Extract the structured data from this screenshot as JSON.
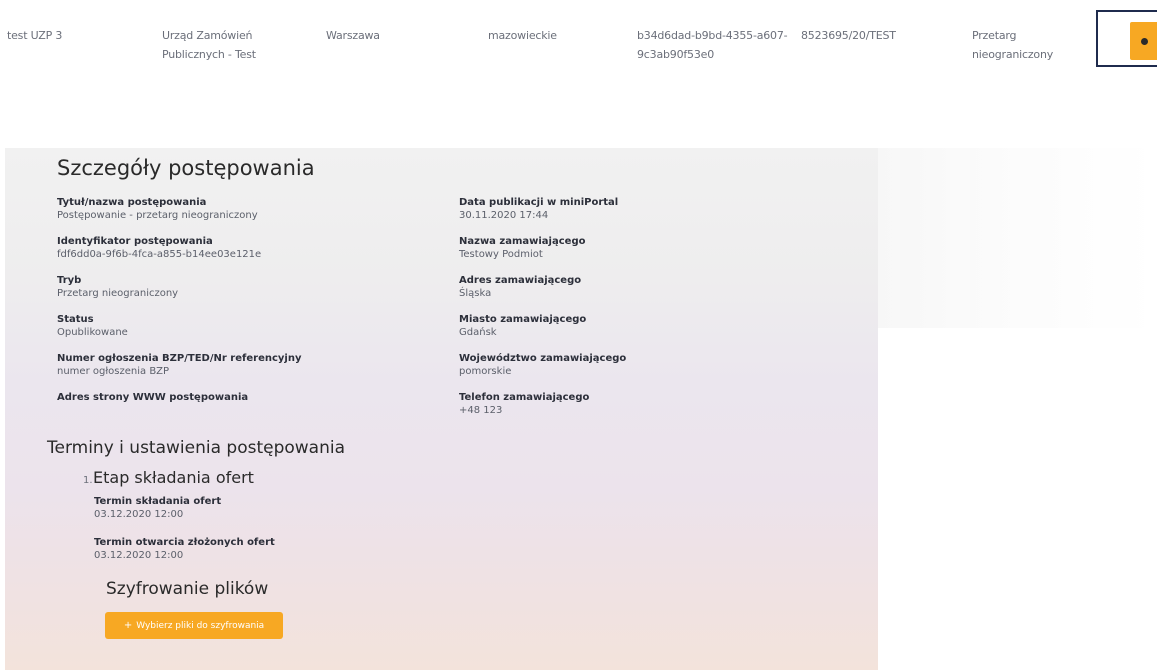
{
  "table_row": {
    "name": "test UZP 3",
    "org": "Urząd Zamówień Publicznych - Test",
    "city": "Warszawa",
    "region": "mazowieckie",
    "identifier": "b34d6dad-b9bd-4355-a607-9c3ab90f53e0",
    "reference": "8523695/20/TEST",
    "mode": "Przetarg nieograniczony"
  },
  "details": {
    "title": "Szczegóły postępowania",
    "left_fields": [
      {
        "label": "Tytuł/nazwa postępowania",
        "value": "Postępowanie - przetarg nieograniczony"
      },
      {
        "label": "Identyfikator postępowania",
        "value": "fdf6dd0a-9f6b-4fca-a855-b14ee03e121e"
      },
      {
        "label": "Tryb",
        "value": "Przetarg nieograniczony"
      },
      {
        "label": "Status",
        "value": "Opublikowane"
      },
      {
        "label": "Numer ogłoszenia BZP/TED/Nr referencyjny",
        "value": "numer ogłoszenia BZP"
      },
      {
        "label": "Adres strony WWW postępowania",
        "value": ""
      }
    ],
    "right_fields": [
      {
        "label": "Data publikacji w miniPortal",
        "value": "30.11.2020 17:44"
      },
      {
        "label": "Nazwa zamawiającego",
        "value": "Testowy Podmiot"
      },
      {
        "label": "Adres zamawiającego",
        "value": "Śląska"
      },
      {
        "label": "Miasto zamawiającego",
        "value": "Gdańsk"
      },
      {
        "label": "Województwo zamawiającego",
        "value": "pomorskie"
      },
      {
        "label": "Telefon zamawiającego",
        "value": "+48 123"
      }
    ]
  },
  "terms": {
    "title": "Terminy i ustawienia postępowania",
    "stage_number": "1.",
    "stage_title": "Etap składania ofert",
    "fields": [
      {
        "label": "Termin składania ofert",
        "value": "03.12.2020 12:00"
      },
      {
        "label": "Termin otwarcia złożonych ofert",
        "value": "03.12.2020 12:00"
      }
    ]
  },
  "encryption": {
    "title": "Szyfrowanie plików",
    "button_plus": "+",
    "button_label": "Wybierz pliki do szyfrowania"
  },
  "colors": {
    "accent": "#f7a823",
    "frame": "#1f2b4d"
  }
}
